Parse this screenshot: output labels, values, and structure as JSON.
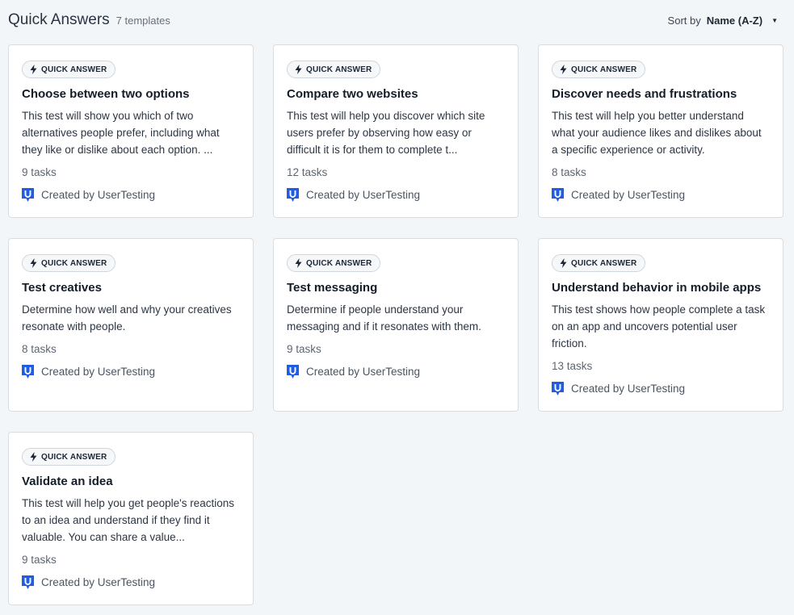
{
  "header": {
    "title": "Quick Answers",
    "count": "7 templates",
    "sort_label": "Sort by",
    "sort_value": "Name (A-Z)"
  },
  "colors": {
    "accent": "#1f5de6",
    "background": "#f3f6f8",
    "card": "#ffffff"
  },
  "cards": [
    {
      "badge": "QUICK ANSWER",
      "title": "Choose between two options",
      "description": "This test will show you which of two alternatives people prefer, including what they like or dislike about each option. ...",
      "tasks": "9 tasks",
      "creator": "Created by UserTesting"
    },
    {
      "badge": "QUICK ANSWER",
      "title": "Compare two websites",
      "description": "This test will help you discover which site users prefer by observing how easy or difficult it is for them to complete t...",
      "tasks": "12 tasks",
      "creator": "Created by UserTesting"
    },
    {
      "badge": "QUICK ANSWER",
      "title": "Discover needs and frustrations",
      "description": "This test will help you better understand what your audience likes and dislikes about a specific experience or activity.",
      "tasks": "8 tasks",
      "creator": "Created by UserTesting"
    },
    {
      "badge": "QUICK ANSWER",
      "title": "Test creatives",
      "description": "Determine how well and why your creatives resonate with people.",
      "tasks": "8 tasks",
      "creator": "Created by UserTesting"
    },
    {
      "badge": "QUICK ANSWER",
      "title": "Test messaging",
      "description": "Determine if people understand your messaging and if it resonates with them.",
      "tasks": "9 tasks",
      "creator": "Created by UserTesting"
    },
    {
      "badge": "QUICK ANSWER",
      "title": "Understand behavior in mobile apps",
      "description": "This test shows how people complete a task on an app and uncovers potential user friction.",
      "tasks": "13 tasks",
      "creator": "Created by UserTesting"
    },
    {
      "badge": "QUICK ANSWER",
      "title": "Validate an idea",
      "description": "This test will help you get people's reactions to an idea and understand if they find it valuable. You can share a value...",
      "tasks": "9 tasks",
      "creator": "Created by UserTesting"
    }
  ]
}
